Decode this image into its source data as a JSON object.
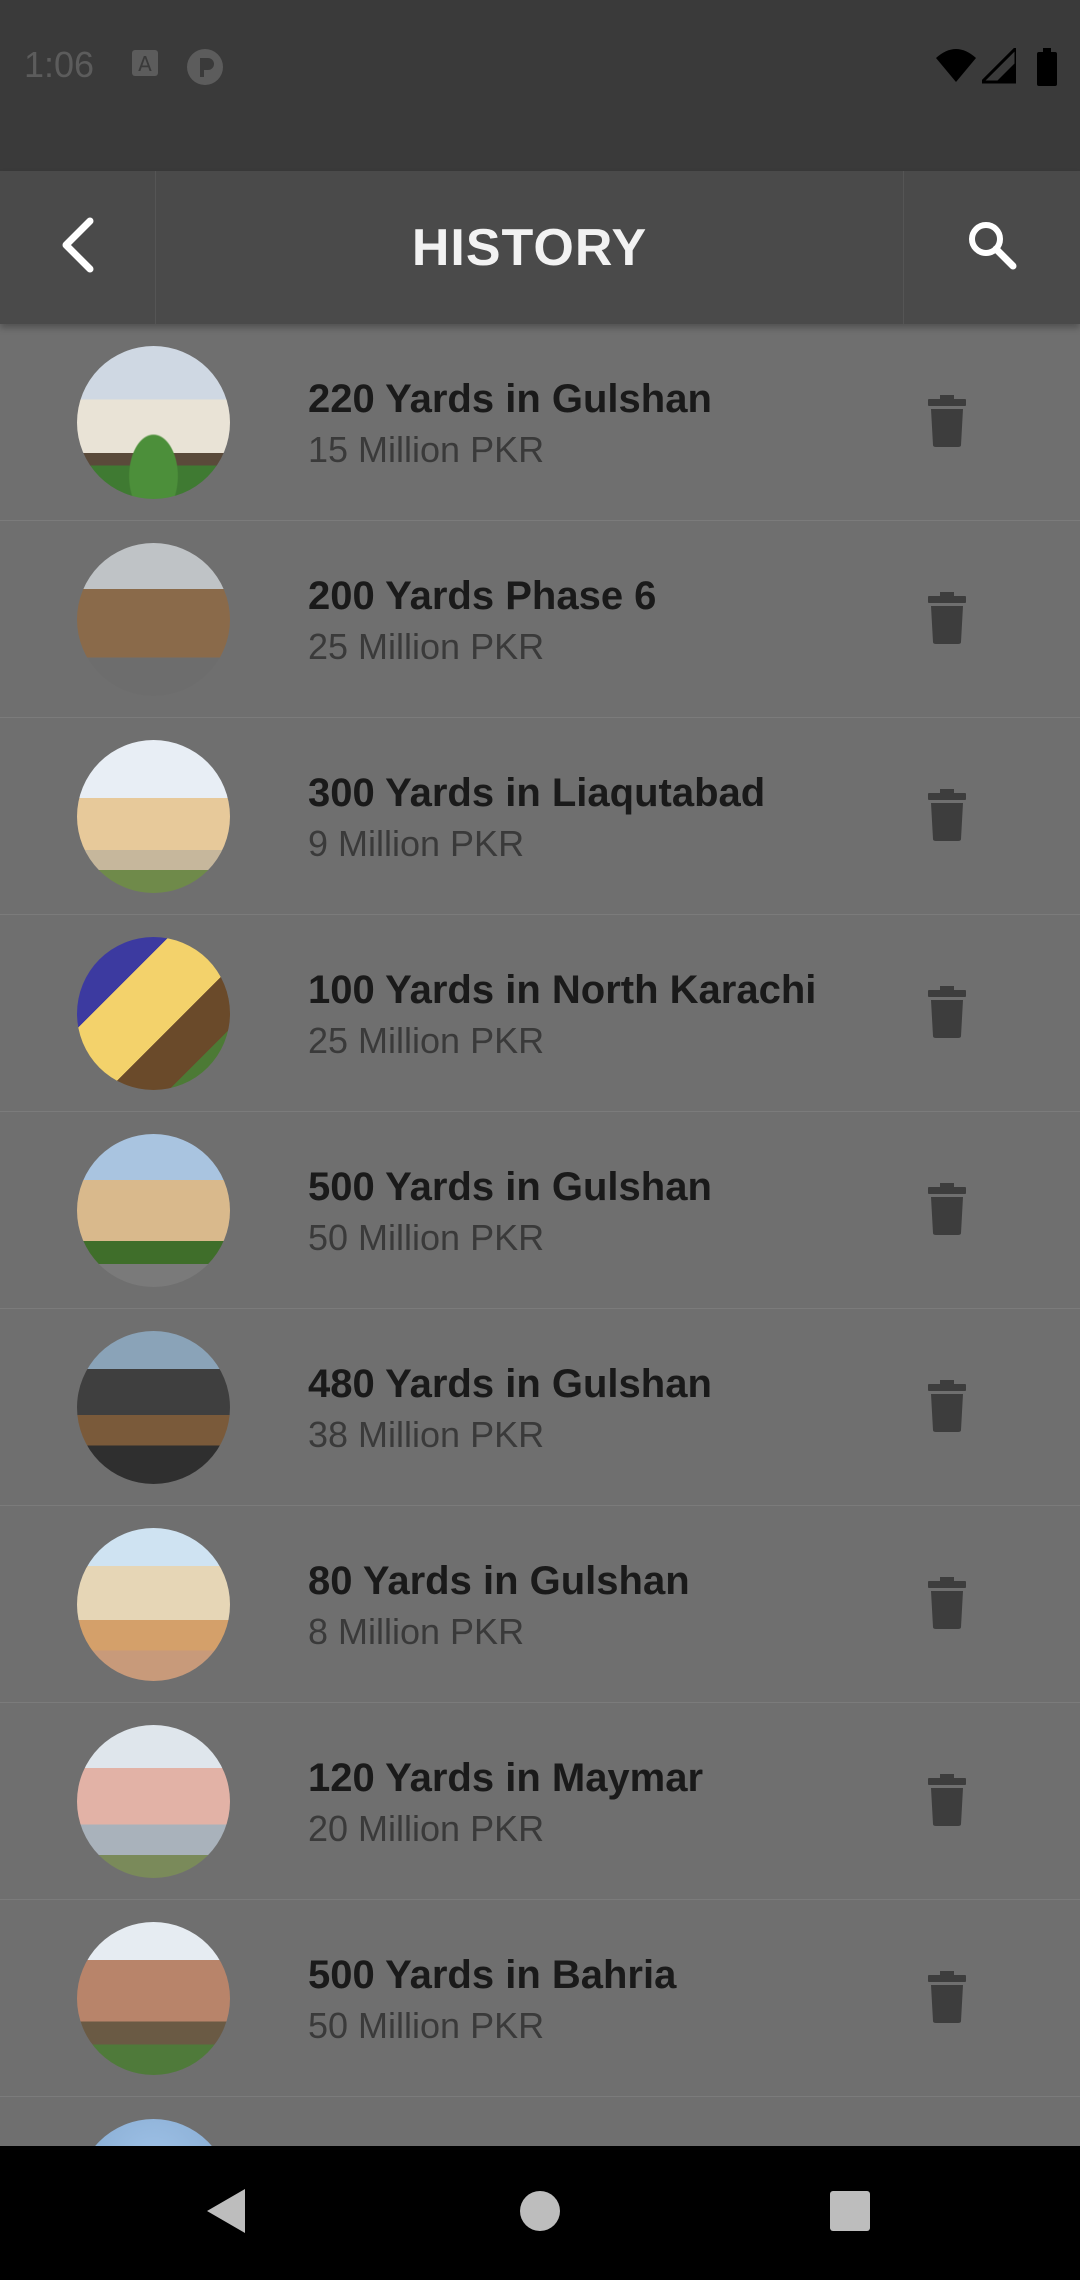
{
  "status_bar": {
    "time": "1:06",
    "icons": [
      "notification-a-icon",
      "app-p-icon",
      "wifi-icon",
      "signal-icon",
      "battery-icon"
    ]
  },
  "app_bar": {
    "title": "HISTORY",
    "back_icon": "chevron-left-icon",
    "search_icon": "search-icon"
  },
  "colors": {
    "background": "#6f6f6f",
    "app_bar": "#4a4a4a",
    "status_bar": "#3a3a3a",
    "title_text": "#1a1a1a",
    "price_text": "#3a3a3a",
    "delete_icon": "#3d3d3d"
  },
  "history": [
    {
      "title": "220 Yards in Gulshan",
      "price": "15 Million PKR"
    },
    {
      "title": "200 Yards Phase 6",
      "price": "25 Million PKR"
    },
    {
      "title": "300 Yards in Liaqutabad",
      "price": "9 Million PKR"
    },
    {
      "title": "100 Yards in North Karachi",
      "price": "25 Million PKR"
    },
    {
      "title": "500 Yards in Gulshan",
      "price": "50 Million PKR"
    },
    {
      "title": "480 Yards in Gulshan",
      "price": "38 Million PKR"
    },
    {
      "title": "80 Yards in Gulshan",
      "price": "8 Million PKR"
    },
    {
      "title": "120 Yards in Maymar",
      "price": "20 Million PKR"
    },
    {
      "title": "500 Yards in Bahria",
      "price": "50 Million PKR"
    }
  ],
  "nav_bar": {
    "back_icon": "triangle-back-icon",
    "home_icon": "circle-home-icon",
    "recents_icon": "square-recents-icon"
  }
}
